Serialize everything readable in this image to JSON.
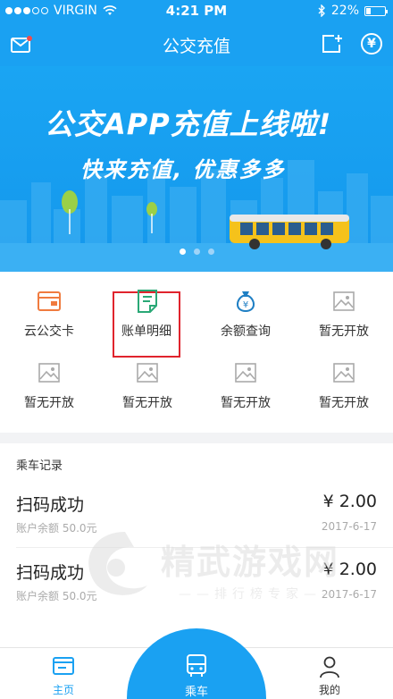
{
  "status_bar": {
    "carrier": "VIRGIN",
    "time": "4:21 PM",
    "battery": "22%"
  },
  "navbar": {
    "title": "公交充值"
  },
  "banner": {
    "headline": "公交APP充值上线啦!",
    "subline": "快来充值, 优惠多多",
    "page_count": 3,
    "active_page": 0
  },
  "grid": {
    "items": [
      {
        "label": "云公交卡",
        "icon": "wallet-icon"
      },
      {
        "label": "账单明细",
        "icon": "bill-icon"
      },
      {
        "label": "余额查询",
        "icon": "money-bag-icon"
      },
      {
        "label": "暂无开放",
        "icon": "image-placeholder-icon"
      },
      {
        "label": "暂无开放",
        "icon": "image-placeholder-icon"
      },
      {
        "label": "暂无开放",
        "icon": "image-placeholder-icon"
      },
      {
        "label": "暂无开放",
        "icon": "image-placeholder-icon"
      },
      {
        "label": "暂无开放",
        "icon": "image-placeholder-icon"
      }
    ]
  },
  "records": {
    "header": "乘车记录",
    "items": [
      {
        "name": "扫码成功",
        "amount": "¥ 2.00",
        "balance": "账户余额 50.0元",
        "date": "2017-6-17"
      },
      {
        "name": "扫码成功",
        "amount": "¥ 2.00",
        "balance": "账户余额 50.0元",
        "date": "2017-6-17"
      }
    ]
  },
  "watermark": {
    "title": "精武游戏网",
    "subtitle": "——排行榜专家——"
  },
  "tabbar": {
    "home": "主页",
    "ride": "乘车",
    "mine": "我的"
  },
  "colors": {
    "primary": "#1aa1f2",
    "highlight": "#e0242d",
    "wallet_orange": "#f07b3f",
    "bill_green": "#2aa876",
    "money_blue": "#1f7fc4"
  }
}
